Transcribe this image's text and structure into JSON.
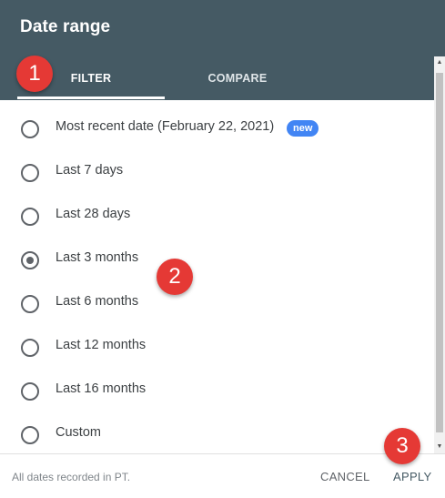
{
  "dialog": {
    "title": "Date range",
    "tabs": [
      {
        "label": "FILTER",
        "active": true
      },
      {
        "label": "COMPARE",
        "active": false
      }
    ],
    "options": [
      {
        "label": "Most recent date (February 22, 2021)",
        "checked": false,
        "badge": "new"
      },
      {
        "label": "Last 7 days",
        "checked": false
      },
      {
        "label": "Last 28 days",
        "checked": false
      },
      {
        "label": "Last 3 months",
        "checked": true
      },
      {
        "label": "Last 6 months",
        "checked": false
      },
      {
        "label": "Last 12 months",
        "checked": false
      },
      {
        "label": "Last 16 months",
        "checked": false
      },
      {
        "label": "Custom",
        "checked": false
      }
    ],
    "footer": {
      "note": "All dates recorded in PT.",
      "cancel_label": "CANCEL",
      "apply_label": "APPLY"
    }
  },
  "annotations": {
    "step1": "1",
    "step2": "2",
    "step3": "3"
  },
  "colors": {
    "header": "#455a64",
    "badge": "#4285f4",
    "annotation": "#e53935"
  }
}
